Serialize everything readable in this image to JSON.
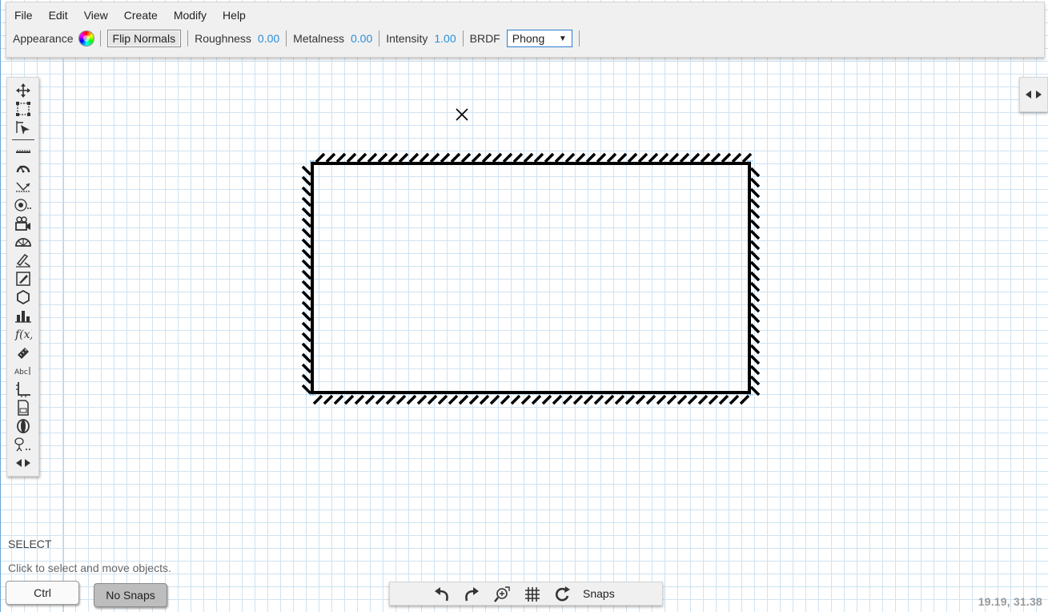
{
  "menu": {
    "items": [
      "File",
      "Edit",
      "View",
      "Create",
      "Modify",
      "Help"
    ]
  },
  "properties": {
    "appearance_label": "Appearance",
    "flip_normals_label": "Flip Normals",
    "roughness_label": "Roughness",
    "roughness_value": "0.00",
    "metalness_label": "Metalness",
    "metalness_value": "0.00",
    "intensity_label": "Intensity",
    "intensity_value": "1.00",
    "brdf_label": "BRDF",
    "brdf_selected": "Phong",
    "value_color": "#2b8fd8"
  },
  "toolbar": {
    "tools": [
      "move-icon",
      "select-rect-icon",
      "select-pointer-icon",
      "ruler-line-icon",
      "protractor-icon",
      "ray-icon",
      "light-source-icon",
      "camera-icon",
      "semicircle-icon",
      "pencil-icon",
      "edit-icon",
      "hexagon-icon",
      "bar-chart-icon",
      "function-icon",
      "ruler-icon",
      "text-icon",
      "axis-icon",
      "document-icon",
      "lens-icon",
      "color-picker-icon",
      "expand-icon"
    ]
  },
  "status": {
    "mode": "SELECT",
    "hint": "Click to select and move objects.",
    "ctrl_label": "Ctrl",
    "snaps_toggle_label": "No Snaps",
    "snaps_label": "Snaps",
    "coordinates": "19.19, 31.38"
  },
  "bottom_bar": {
    "icons": [
      "undo-icon",
      "redo-icon",
      "zoom-fit-icon",
      "grid-icon",
      "rotate-icon"
    ]
  },
  "scene": {
    "stroke_color": "#000000",
    "selection_color": "#2b8fd8"
  }
}
